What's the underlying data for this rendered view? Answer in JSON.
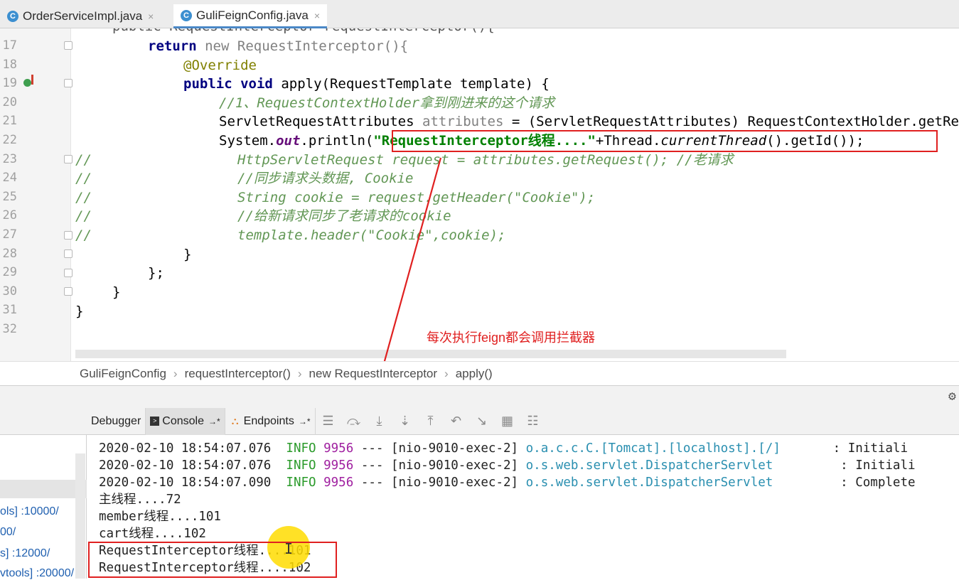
{
  "tabs": [
    {
      "icon": "C",
      "label": "OrderServiceImpl.java",
      "close": "×"
    },
    {
      "icon": "C",
      "label": "GuliFeignConfig.java",
      "close": "×"
    }
  ],
  "editor": {
    "line_numbers": [
      "17",
      "18",
      "19",
      "20",
      "21",
      "22",
      "23",
      "24",
      "25",
      "26",
      "27",
      "28",
      "29",
      "30",
      "31",
      "32"
    ],
    "l16": "public RequestInterceptor requestInterceptor(){",
    "l17": {
      "kw1": "return",
      "kw2": "new",
      "rest": "RequestInterceptor(){"
    },
    "l18": "@Override",
    "l19": {
      "kw1": "public",
      "kw2": "void",
      "rest": "apply(RequestTemplate template) {"
    },
    "l20": "//1、RequestContextHolder拿到刚进来的这个请求",
    "l21": {
      "type": "ServletRequestAttributes",
      "var": "attributes",
      "rest": " = (ServletRequestAttributes) RequestContextHolder.getRequestAttributes();"
    },
    "l22": {
      "a": "System.",
      "field": "out",
      "b": ".println(",
      "str": "\"RequestInterceptor线程....\"",
      "c": "+Thread.",
      "method": "currentThread",
      "d": "().getId());"
    },
    "l23": {
      "slash": "//",
      "text": "HttpServletRequest request = attributes.getRequest(); //老请求"
    },
    "l24": {
      "slash": "//",
      "text": "//同步请求头数据, Cookie"
    },
    "l25": {
      "slash": "//",
      "text": "String cookie = request.getHeader(\"Cookie\");"
    },
    "l26": {
      "slash": "//",
      "text": "//给新请求同步了老请求的cookie"
    },
    "l27": {
      "slash": "//",
      "text": "template.header(\"Cookie\",cookie);"
    },
    "l28": "}",
    "l29": "};",
    "l30": "}",
    "l31": "}"
  },
  "annotation": "每次执行feign都会调用拦截器",
  "breadcrumbs": [
    "GuliFeignConfig",
    "requestInterceptor()",
    "new RequestInterceptor",
    "apply()"
  ],
  "left_panel": [
    "ols] :10000/",
    "00/",
    "s] :12000/",
    "vtools] :20000/"
  ],
  "debug_tabs": {
    "debugger": "Debugger",
    "console": "Console",
    "console_pin": "→*",
    "endpoints": "Endpoints",
    "endpoints_pin": "→*"
  },
  "console": {
    "log": [
      {
        "ts": "2020-02-10 18:54:07.076",
        "level": "INFO",
        "pid": "9956",
        "sep": "---",
        "thread": "[nio-9010-exec-2]",
        "logger": "o.a.c.c.C.[Tomcat].[localhost].[/]",
        "msg": ": Initiali"
      },
      {
        "ts": "2020-02-10 18:54:07.076",
        "level": "INFO",
        "pid": "9956",
        "sep": "---",
        "thread": "[nio-9010-exec-2]",
        "logger": "o.s.web.servlet.DispatcherServlet",
        "msg": ": Initiali"
      },
      {
        "ts": "2020-02-10 18:54:07.090",
        "level": "INFO",
        "pid": "9956",
        "sep": "---",
        "thread": "[nio-9010-exec-2]",
        "logger": "o.s.web.servlet.DispatcherServlet",
        "msg": ": Complete"
      }
    ],
    "out": [
      "主线程....72",
      "member线程....101",
      "cart线程....102",
      "RequestInterceptor线程....101",
      "RequestInterceptor线程....102"
    ]
  },
  "colors": {
    "accent": "#4a88c7",
    "annotation_red": "#e02020",
    "string_green": "#008000",
    "keyword_navy": "#000080"
  }
}
